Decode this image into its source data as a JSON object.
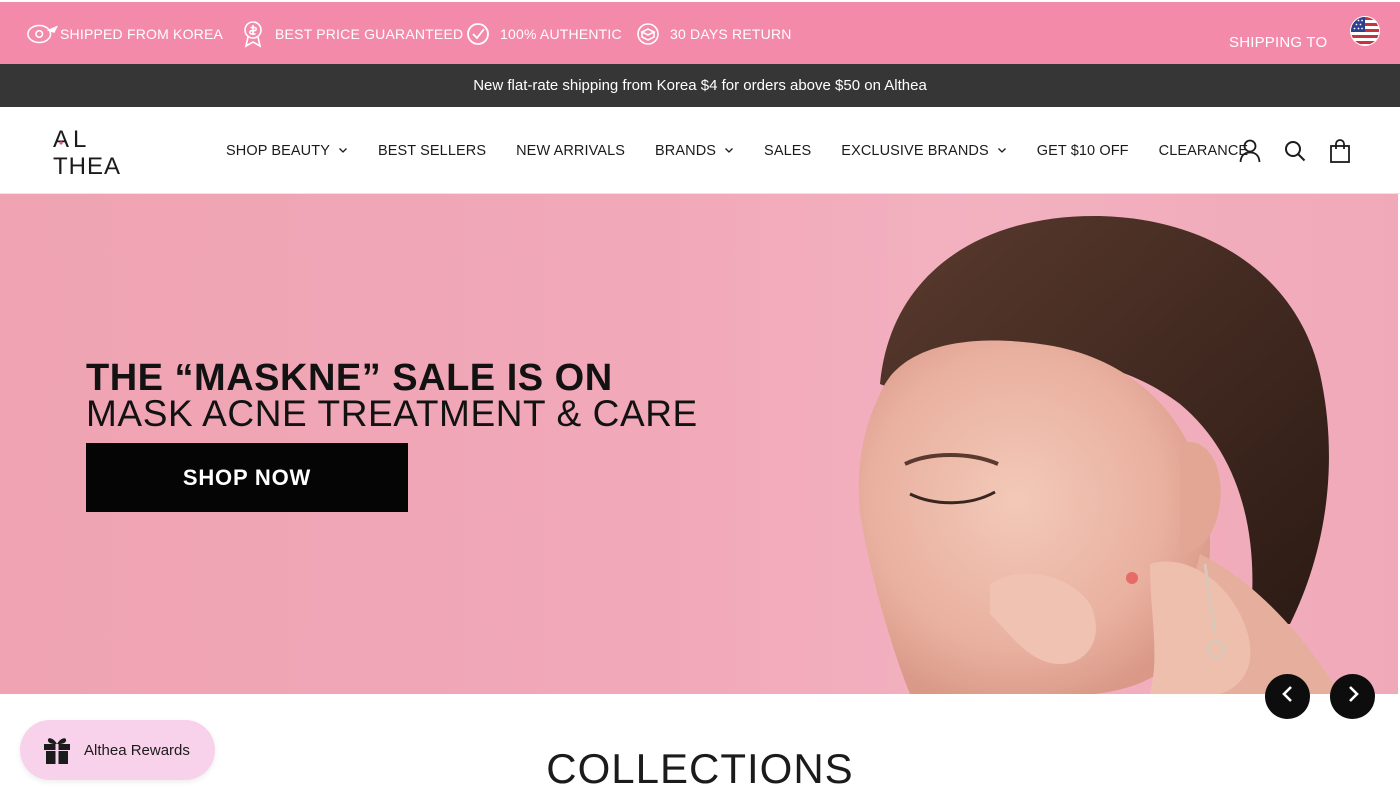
{
  "topbar": {
    "usps": [
      {
        "icon": "airplane-icon",
        "label": "SHIPPED FROM KOREA"
      },
      {
        "icon": "price-medal-icon",
        "label": "BEST PRICE GUARANTEED"
      },
      {
        "icon": "checkmark-icon",
        "label": "100% AUTHENTIC"
      },
      {
        "icon": "return-box-icon",
        "label": "30 DAYS RETURN"
      }
    ],
    "shipping_to": "SHIPPING TO",
    "flag": "us-flag-icon",
    "bg_color": "#f48aaa"
  },
  "announcement": {
    "text": "New flat-rate shipping from Korea $4 for orders above $50 on Althea",
    "bg_color": "#363636"
  },
  "header": {
    "logo_text_top": "AL",
    "logo_text_bottom": "THEA",
    "nav": [
      {
        "label": "SHOP BEAUTY",
        "has_dropdown": true
      },
      {
        "label": "BEST SELLERS",
        "has_dropdown": false
      },
      {
        "label": "NEW ARRIVALS",
        "has_dropdown": false
      },
      {
        "label": "BRANDS",
        "has_dropdown": true
      },
      {
        "label": "SALES",
        "has_dropdown": false
      },
      {
        "label": "EXCLUSIVE BRANDS",
        "has_dropdown": true
      },
      {
        "label": "GET $10 OFF",
        "has_dropdown": false
      },
      {
        "label": "CLEARANCE",
        "has_dropdown": false
      }
    ],
    "icons": [
      "account-icon",
      "search-icon",
      "cart-bag-icon"
    ]
  },
  "hero": {
    "title_line1": "THE “MASKNE” SALE IS ON",
    "title_line2": "MASK ACNE TREATMENT & CARE",
    "cta": "SHOP NOW",
    "bg_color": "#f1a8b8"
  },
  "slider": {
    "prev_icon": "chevron-left-icon",
    "next_icon": "chevron-right-icon"
  },
  "collections": {
    "heading": "COLLECTIONS"
  },
  "rewards": {
    "label": "Althea Rewards",
    "icon": "gift-icon",
    "bg_color": "#f7d2ea"
  }
}
